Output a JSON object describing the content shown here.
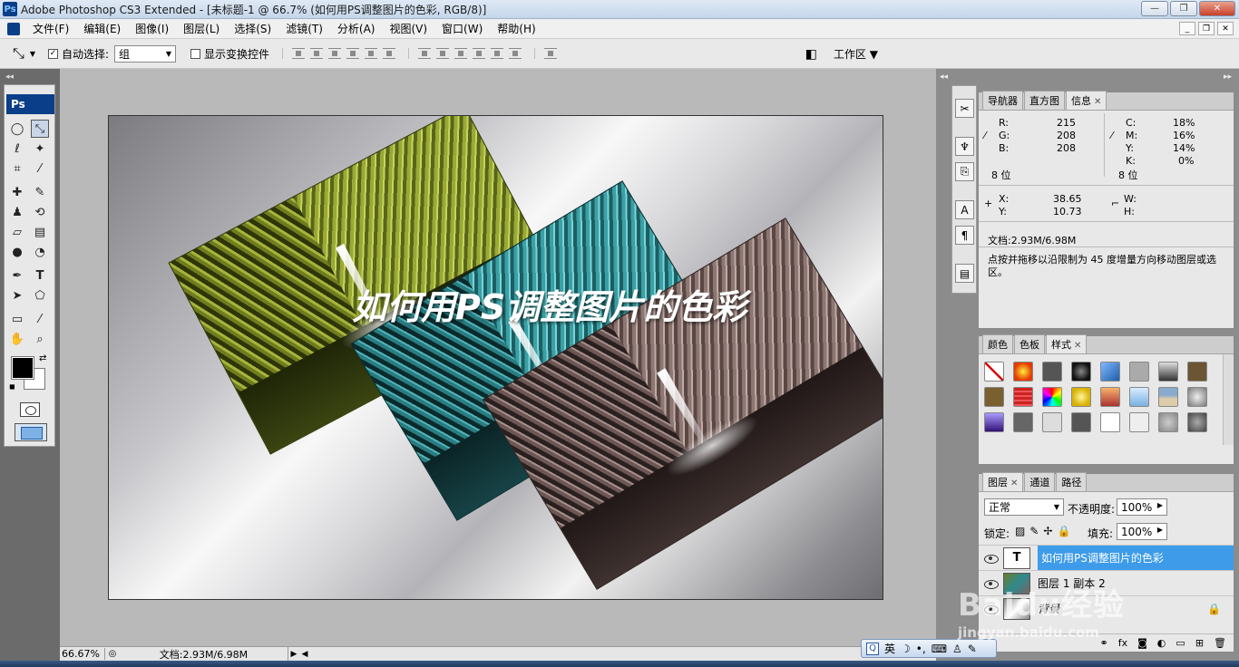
{
  "window": {
    "title": "Adobe Photoshop CS3 Extended - [未标题-1 @ 66.7% (如何用PS调整图片的色彩, RGB/8)]"
  },
  "menu": [
    "文件(F)",
    "编辑(E)",
    "图像(I)",
    "图层(L)",
    "选择(S)",
    "滤镜(T)",
    "分析(A)",
    "视图(V)",
    "窗口(W)",
    "帮助(H)"
  ],
  "options": {
    "auto_select_label": "自动选择:",
    "auto_select_value": "组",
    "show_transform_label": "显示变换控件",
    "workspace_label": "工作区"
  },
  "toolbox": {
    "logo": "Ps"
  },
  "canvas": {
    "headline": "如何用PS调整图片的色彩"
  },
  "status": {
    "zoom": "66.67%",
    "doc": "文档:2.93M/6.98M"
  },
  "panels": {
    "info": {
      "tabs": [
        "导航器",
        "直方图",
        "信息"
      ],
      "rgb": {
        "r_label": "R:",
        "r": "215",
        "g_label": "G:",
        "g": "208",
        "b_label": "B:",
        "b": "208",
        "bits": "8 位"
      },
      "cmyk": {
        "c_label": "C:",
        "c": "18%",
        "m_label": "M:",
        "m": "16%",
        "y_label": "Y:",
        "y": "14%",
        "k_label": "K:",
        "k": "0%",
        "bits": "8 位"
      },
      "xy": {
        "x_label": "X:",
        "x": "38.65",
        "y_label": "Y:",
        "y": "10.73",
        "w_label": "W:",
        "h_label": "H:"
      },
      "doc": "文档:2.93M/6.98M",
      "hint": "点按并拖移以沿限制为 45 度增量方向移动图层或选区。"
    },
    "styles": {
      "tabs": [
        "颜色",
        "色板",
        "样式"
      ]
    },
    "layers": {
      "tabs": [
        "图层",
        "通道",
        "路径"
      ],
      "blend_mode": "正常",
      "opacity_label": "不透明度:",
      "opacity": "100%",
      "lock_label": "锁定:",
      "fill_label": "填充:",
      "fill": "100%",
      "items": [
        {
          "name": "如何用PS调整图片的色彩",
          "thumb": "T"
        },
        {
          "name": "图层 1 副本 2",
          "thumb": ""
        },
        {
          "name": "背景",
          "thumb": ""
        }
      ]
    }
  },
  "ime": {
    "lang": "英"
  },
  "watermark": {
    "brand": "Baidu经验",
    "url": "jingyan.baidu.com"
  }
}
